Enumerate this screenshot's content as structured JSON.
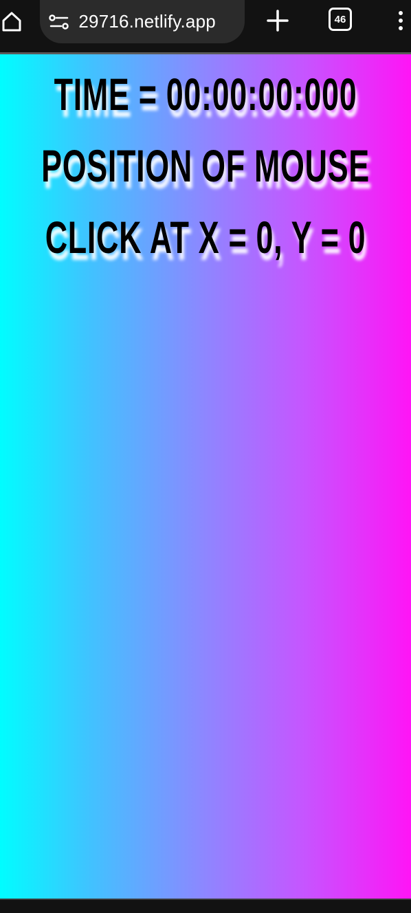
{
  "browser": {
    "url": " 29716.netlify.app",
    "tab_count": "46"
  },
  "content": {
    "time_line": "TIME = 00:00:00:000",
    "position_line_1": "POSITION OF MOUSE",
    "position_line_2": "CLICK AT X = 0, Y = 0"
  },
  "colors": {
    "gradient_start": "#00fdff",
    "gradient_end": "#ff14f6",
    "browser_chrome": "#121212",
    "url_pill": "#2b2b2b"
  },
  "icons": {
    "home": "home-icon",
    "site_info": "site-settings-icon",
    "new_tab": "plus-icon",
    "tabs": "tab-switcher-icon",
    "menu": "more-vert-icon"
  }
}
